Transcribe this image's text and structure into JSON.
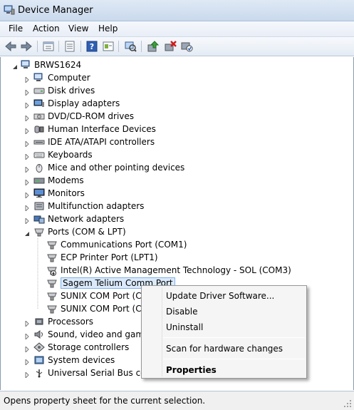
{
  "window": {
    "title": "Device Manager"
  },
  "menu": [
    {
      "id": "file",
      "label": "File"
    },
    {
      "id": "action",
      "label": "Action"
    },
    {
      "id": "view",
      "label": "View"
    },
    {
      "id": "help",
      "label": "Help"
    }
  ],
  "toolbar": {
    "buttons": [
      "back-icon",
      "forward-icon",
      "up-view-icon",
      "properties-icon",
      "help-icon",
      "action-view-icon",
      "scan-hardware-icon",
      "update-driver-icon",
      "uninstall-icon",
      "disable-icon"
    ]
  },
  "tree": {
    "root": "BRWS1624",
    "categories": [
      {
        "label": "Computer",
        "icon": "computer-icon",
        "expanded": false
      },
      {
        "label": "Disk drives",
        "icon": "disk-drive-icon",
        "expanded": false
      },
      {
        "label": "Display adapters",
        "icon": "display-adapter-icon",
        "expanded": false
      },
      {
        "label": "DVD/CD-ROM drives",
        "icon": "dvd-drive-icon",
        "expanded": false
      },
      {
        "label": "Human Interface Devices",
        "icon": "hid-icon",
        "expanded": false
      },
      {
        "label": "IDE ATA/ATAPI controllers",
        "icon": "ide-controller-icon",
        "expanded": false
      },
      {
        "label": "Keyboards",
        "icon": "keyboard-icon",
        "expanded": false
      },
      {
        "label": "Mice and other pointing devices",
        "icon": "mouse-icon",
        "expanded": false
      },
      {
        "label": "Modems",
        "icon": "modem-icon",
        "expanded": false
      },
      {
        "label": "Monitors",
        "icon": "monitor-icon",
        "expanded": false
      },
      {
        "label": "Multifunction adapters",
        "icon": "multifunction-icon",
        "expanded": false
      },
      {
        "label": "Network adapters",
        "icon": "network-adapter-icon",
        "expanded": false
      },
      {
        "label": "Ports (COM & LPT)",
        "icon": "port-icon",
        "expanded": true
      },
      {
        "label": "Processors",
        "icon": "processor-icon",
        "expanded": false
      },
      {
        "label": "Sound, video and game c",
        "icon": "sound-icon",
        "expanded": false
      },
      {
        "label": "Storage controllers",
        "icon": "storage-controller-icon",
        "expanded": false
      },
      {
        "label": "System devices",
        "icon": "system-device-icon",
        "expanded": false
      },
      {
        "label": "Universal Serial Bus contr",
        "icon": "usb-icon",
        "expanded": false
      }
    ],
    "ports": [
      {
        "label": "Communications Port (COM1)",
        "selected": false,
        "warning": false
      },
      {
        "label": "ECP Printer Port (LPT1)",
        "selected": false,
        "warning": false
      },
      {
        "label": "Intel(R) Active Management Technology - SOL (COM3)",
        "selected": false,
        "warning": true
      },
      {
        "label": "Sagem Telium Comm Port",
        "selected": true,
        "warning": false
      },
      {
        "label": "SUNIX COM Port (CO",
        "selected": false,
        "warning": false
      },
      {
        "label": "SUNIX COM Port (CO",
        "selected": false,
        "warning": false
      }
    ]
  },
  "context_menu": {
    "items": [
      {
        "label": "Update Driver Software...",
        "bold": false
      },
      {
        "label": "Disable",
        "bold": false
      },
      {
        "label": "Uninstall",
        "bold": false
      },
      {
        "label": "Scan for hardware changes",
        "bold": false
      },
      {
        "label": "Properties",
        "bold": true
      }
    ]
  },
  "status": {
    "text": "Opens property sheet for the current selection."
  },
  "colors": {
    "selection": "#dbeafb",
    "selection_border": "#7fb1e6",
    "titlebar": "#c9d9ec"
  }
}
